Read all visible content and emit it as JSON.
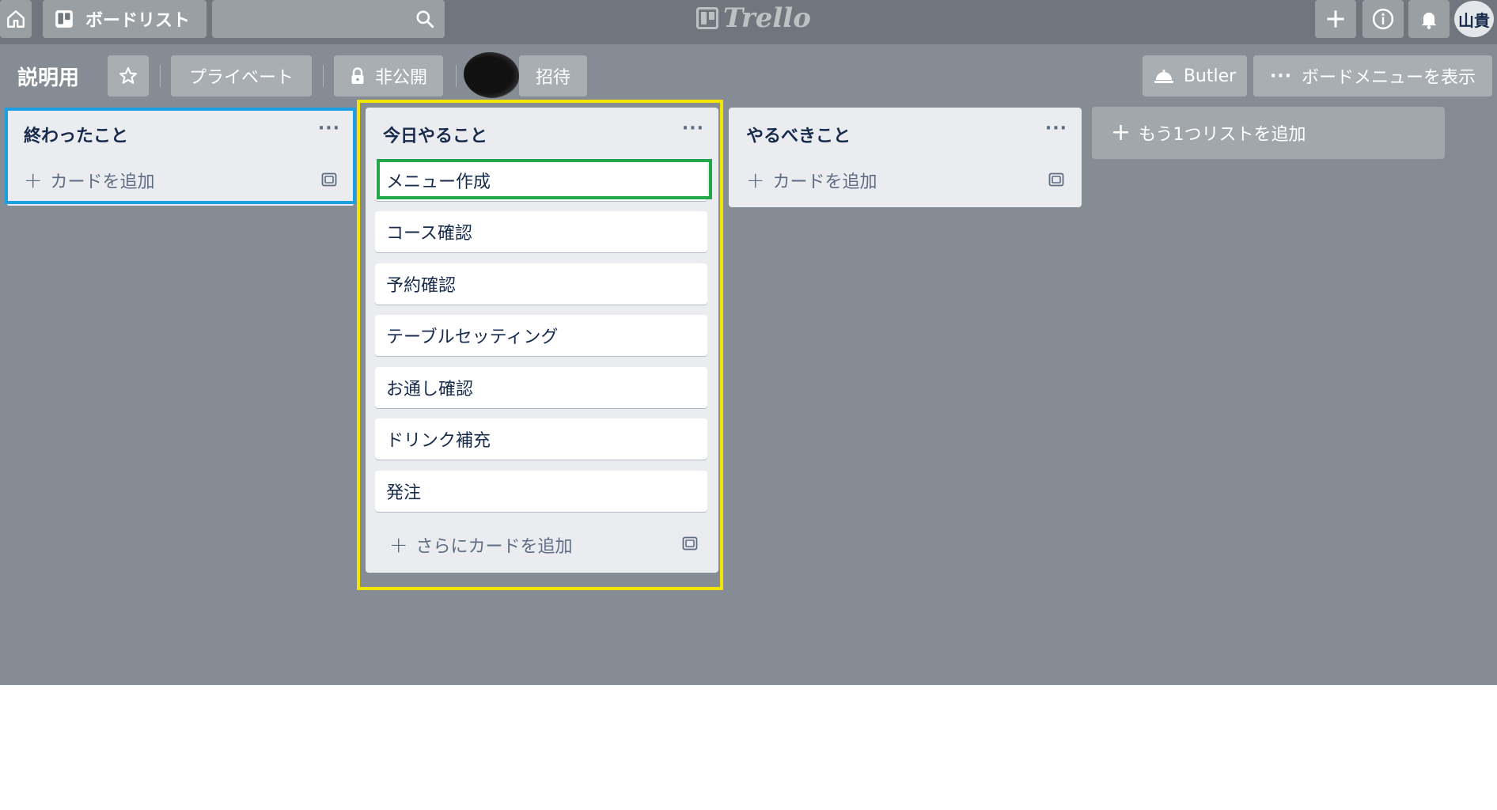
{
  "app": {
    "logo_text": "Trello",
    "board_list_label": "ボードリスト",
    "avatar_initials": "山貴"
  },
  "board": {
    "title": "説明用",
    "privacy_label": "プライベート",
    "visibility_label": "非公開",
    "invite_label": "招待",
    "butler_label": "Butler",
    "menu_label": "ボードメニューを表示"
  },
  "lists": [
    {
      "title": "終わったこと",
      "add_label": "カードを追加",
      "cards": []
    },
    {
      "title": "今日やること",
      "add_label": "さらにカードを追加",
      "cards": [
        "メニュー作成",
        "コース確認",
        "予約確認",
        "テーブルセッティング",
        "お通し確認",
        "ドリンク補充",
        "発注"
      ]
    },
    {
      "title": "やるべきこと",
      "add_label": "カードを追加",
      "cards": []
    }
  ],
  "add_list_label": "もう1つリストを追加",
  "highlight_colors": {
    "list_done": "#1aa0e0",
    "list_today": "#f2e600",
    "card_selected": "#22a84a"
  }
}
